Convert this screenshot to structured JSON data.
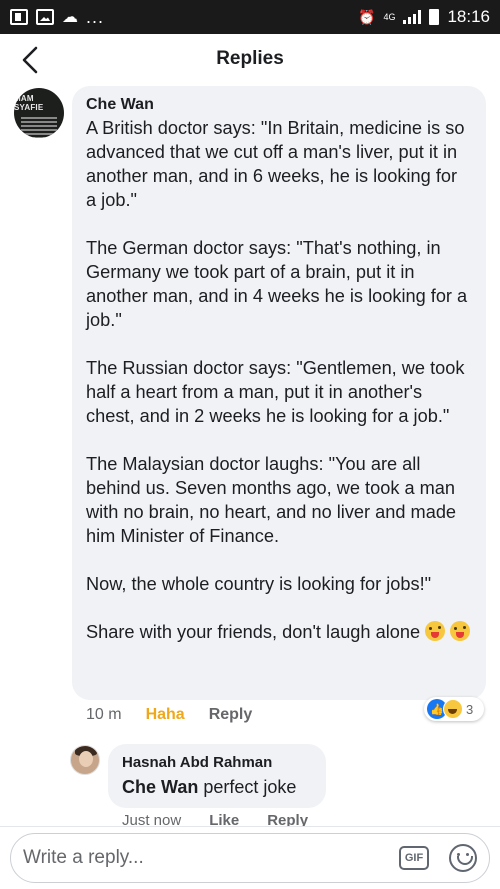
{
  "status_bar": {
    "time": "18:16",
    "network": "4G"
  },
  "header": {
    "title": "Replies"
  },
  "comment": {
    "author": "Che Wan",
    "avatar_text": "MAM SYAFIE",
    "paragraphs": [
      "A British doctor says: \"In Britain, medicine is so advanced that we cut off a man's liver, put it in another man, and in 6 weeks, he is looking for a job.\"",
      "The German doctor says: \"That's nothing, in Germany we took part of a brain, put it in another man, and in 4 weeks he is looking for a job.\"",
      "The Russian doctor says: \"Gentlemen, we took half a heart from a man, put it in another's chest, and in 2 weeks he is looking for a job.\"",
      "The Malaysian doctor laughs: \"You are all behind us. Seven months ago, we took a man with no brain, no heart, and no liver and made him Minister of Finance.",
      "Now, the whole country is looking for jobs!\"",
      "Share with your friends, don't laugh alone"
    ],
    "time": "10 m",
    "reaction_label": "Haha",
    "reply_label": "Reply",
    "reaction_count": "3",
    "reaction_icons": [
      "like-icon",
      "haha-icon"
    ]
  },
  "reply": {
    "author": "Hasnah Abd Rahman",
    "mention": "Che Wan",
    "text": "perfect joke",
    "time": "Just now",
    "like_label": "Like",
    "reply_label": "Reply"
  },
  "composer": {
    "placeholder": "Write a reply...",
    "gif_label": "GIF"
  },
  "colors": {
    "bubble": "#f0f2f5",
    "haha": "#f0a81b",
    "like_blue": "#1877f2",
    "muted": "#65676b",
    "status_bar": "#1a1a1a"
  }
}
